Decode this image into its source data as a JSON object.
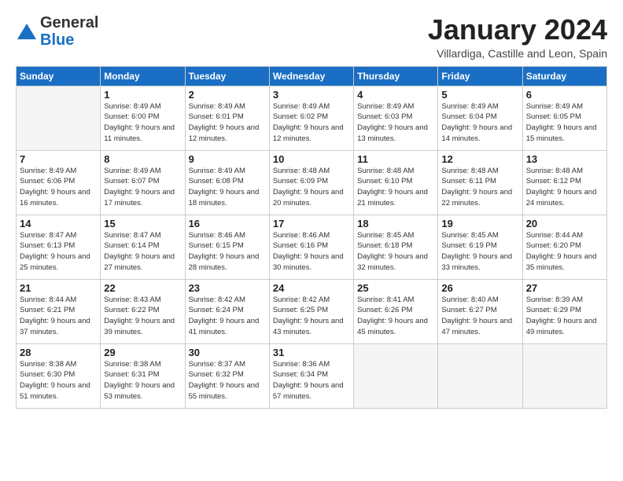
{
  "header": {
    "logo_general": "General",
    "logo_blue": "Blue",
    "month": "January 2024",
    "location": "Villardiga, Castille and Leon, Spain"
  },
  "weekdays": [
    "Sunday",
    "Monday",
    "Tuesday",
    "Wednesday",
    "Thursday",
    "Friday",
    "Saturday"
  ],
  "weeks": [
    [
      {
        "day": "",
        "sunrise": "",
        "sunset": "",
        "daylight": ""
      },
      {
        "day": "1",
        "sunrise": "Sunrise: 8:49 AM",
        "sunset": "Sunset: 6:00 PM",
        "daylight": "Daylight: 9 hours and 11 minutes."
      },
      {
        "day": "2",
        "sunrise": "Sunrise: 8:49 AM",
        "sunset": "Sunset: 6:01 PM",
        "daylight": "Daylight: 9 hours and 12 minutes."
      },
      {
        "day": "3",
        "sunrise": "Sunrise: 8:49 AM",
        "sunset": "Sunset: 6:02 PM",
        "daylight": "Daylight: 9 hours and 12 minutes."
      },
      {
        "day": "4",
        "sunrise": "Sunrise: 8:49 AM",
        "sunset": "Sunset: 6:03 PM",
        "daylight": "Daylight: 9 hours and 13 minutes."
      },
      {
        "day": "5",
        "sunrise": "Sunrise: 8:49 AM",
        "sunset": "Sunset: 6:04 PM",
        "daylight": "Daylight: 9 hours and 14 minutes."
      },
      {
        "day": "6",
        "sunrise": "Sunrise: 8:49 AM",
        "sunset": "Sunset: 6:05 PM",
        "daylight": "Daylight: 9 hours and 15 minutes."
      }
    ],
    [
      {
        "day": "7",
        "sunrise": "Sunrise: 8:49 AM",
        "sunset": "Sunset: 6:06 PM",
        "daylight": "Daylight: 9 hours and 16 minutes."
      },
      {
        "day": "8",
        "sunrise": "Sunrise: 8:49 AM",
        "sunset": "Sunset: 6:07 PM",
        "daylight": "Daylight: 9 hours and 17 minutes."
      },
      {
        "day": "9",
        "sunrise": "Sunrise: 8:49 AM",
        "sunset": "Sunset: 6:08 PM",
        "daylight": "Daylight: 9 hours and 18 minutes."
      },
      {
        "day": "10",
        "sunrise": "Sunrise: 8:48 AM",
        "sunset": "Sunset: 6:09 PM",
        "daylight": "Daylight: 9 hours and 20 minutes."
      },
      {
        "day": "11",
        "sunrise": "Sunrise: 8:48 AM",
        "sunset": "Sunset: 6:10 PM",
        "daylight": "Daylight: 9 hours and 21 minutes."
      },
      {
        "day": "12",
        "sunrise": "Sunrise: 8:48 AM",
        "sunset": "Sunset: 6:11 PM",
        "daylight": "Daylight: 9 hours and 22 minutes."
      },
      {
        "day": "13",
        "sunrise": "Sunrise: 8:48 AM",
        "sunset": "Sunset: 6:12 PM",
        "daylight": "Daylight: 9 hours and 24 minutes."
      }
    ],
    [
      {
        "day": "14",
        "sunrise": "Sunrise: 8:47 AM",
        "sunset": "Sunset: 6:13 PM",
        "daylight": "Daylight: 9 hours and 25 minutes."
      },
      {
        "day": "15",
        "sunrise": "Sunrise: 8:47 AM",
        "sunset": "Sunset: 6:14 PM",
        "daylight": "Daylight: 9 hours and 27 minutes."
      },
      {
        "day": "16",
        "sunrise": "Sunrise: 8:46 AM",
        "sunset": "Sunset: 6:15 PM",
        "daylight": "Daylight: 9 hours and 28 minutes."
      },
      {
        "day": "17",
        "sunrise": "Sunrise: 8:46 AM",
        "sunset": "Sunset: 6:16 PM",
        "daylight": "Daylight: 9 hours and 30 minutes."
      },
      {
        "day": "18",
        "sunrise": "Sunrise: 8:45 AM",
        "sunset": "Sunset: 6:18 PM",
        "daylight": "Daylight: 9 hours and 32 minutes."
      },
      {
        "day": "19",
        "sunrise": "Sunrise: 8:45 AM",
        "sunset": "Sunset: 6:19 PM",
        "daylight": "Daylight: 9 hours and 33 minutes."
      },
      {
        "day": "20",
        "sunrise": "Sunrise: 8:44 AM",
        "sunset": "Sunset: 6:20 PM",
        "daylight": "Daylight: 9 hours and 35 minutes."
      }
    ],
    [
      {
        "day": "21",
        "sunrise": "Sunrise: 8:44 AM",
        "sunset": "Sunset: 6:21 PM",
        "daylight": "Daylight: 9 hours and 37 minutes."
      },
      {
        "day": "22",
        "sunrise": "Sunrise: 8:43 AM",
        "sunset": "Sunset: 6:22 PM",
        "daylight": "Daylight: 9 hours and 39 minutes."
      },
      {
        "day": "23",
        "sunrise": "Sunrise: 8:42 AM",
        "sunset": "Sunset: 6:24 PM",
        "daylight": "Daylight: 9 hours and 41 minutes."
      },
      {
        "day": "24",
        "sunrise": "Sunrise: 8:42 AM",
        "sunset": "Sunset: 6:25 PM",
        "daylight": "Daylight: 9 hours and 43 minutes."
      },
      {
        "day": "25",
        "sunrise": "Sunrise: 8:41 AM",
        "sunset": "Sunset: 6:26 PM",
        "daylight": "Daylight: 9 hours and 45 minutes."
      },
      {
        "day": "26",
        "sunrise": "Sunrise: 8:40 AM",
        "sunset": "Sunset: 6:27 PM",
        "daylight": "Daylight: 9 hours and 47 minutes."
      },
      {
        "day": "27",
        "sunrise": "Sunrise: 8:39 AM",
        "sunset": "Sunset: 6:29 PM",
        "daylight": "Daylight: 9 hours and 49 minutes."
      }
    ],
    [
      {
        "day": "28",
        "sunrise": "Sunrise: 8:38 AM",
        "sunset": "Sunset: 6:30 PM",
        "daylight": "Daylight: 9 hours and 51 minutes."
      },
      {
        "day": "29",
        "sunrise": "Sunrise: 8:38 AM",
        "sunset": "Sunset: 6:31 PM",
        "daylight": "Daylight: 9 hours and 53 minutes."
      },
      {
        "day": "30",
        "sunrise": "Sunrise: 8:37 AM",
        "sunset": "Sunset: 6:32 PM",
        "daylight": "Daylight: 9 hours and 55 minutes."
      },
      {
        "day": "31",
        "sunrise": "Sunrise: 8:36 AM",
        "sunset": "Sunset: 6:34 PM",
        "daylight": "Daylight: 9 hours and 57 minutes."
      },
      {
        "day": "",
        "sunrise": "",
        "sunset": "",
        "daylight": ""
      },
      {
        "day": "",
        "sunrise": "",
        "sunset": "",
        "daylight": ""
      },
      {
        "day": "",
        "sunrise": "",
        "sunset": "",
        "daylight": ""
      }
    ]
  ]
}
